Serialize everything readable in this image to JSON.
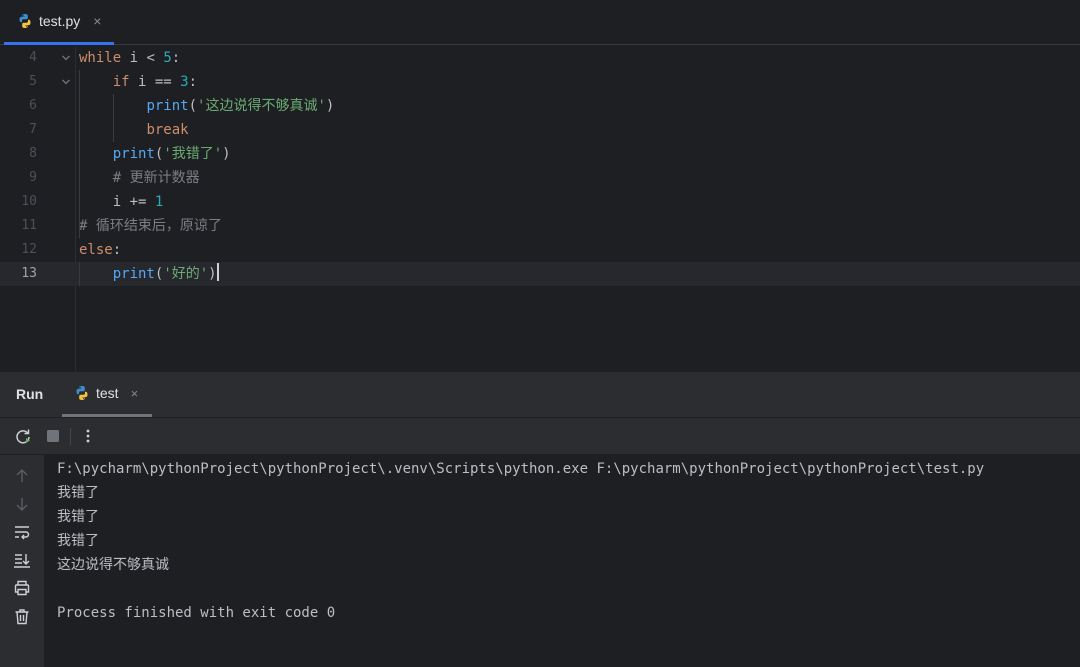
{
  "editor_tab": {
    "label": "test.py",
    "close": "×"
  },
  "editor": {
    "lines": [
      {
        "num": "4",
        "tokens": [
          [
            "kw",
            "while"
          ],
          [
            "p",
            " i < "
          ],
          [
            "num",
            "5"
          ],
          [
            "p",
            ":"
          ]
        ]
      },
      {
        "num": "5",
        "tokens": [
          [
            "p",
            "    "
          ],
          [
            "kw",
            "if"
          ],
          [
            "p",
            " i == "
          ],
          [
            "num",
            "3"
          ],
          [
            "p",
            ":"
          ]
        ]
      },
      {
        "num": "6",
        "tokens": [
          [
            "p",
            "        "
          ],
          [
            "fn",
            "print"
          ],
          [
            "p",
            "("
          ],
          [
            "str",
            "'这边说得不够真诚'"
          ],
          [
            "p",
            ")"
          ]
        ]
      },
      {
        "num": "7",
        "tokens": [
          [
            "p",
            "        "
          ],
          [
            "kw",
            "break"
          ]
        ]
      },
      {
        "num": "8",
        "tokens": [
          [
            "p",
            "    "
          ],
          [
            "fn",
            "print"
          ],
          [
            "p",
            "("
          ],
          [
            "str",
            "'我错了'"
          ],
          [
            "p",
            ")"
          ]
        ]
      },
      {
        "num": "9",
        "tokens": [
          [
            "p",
            "    "
          ],
          [
            "cmt",
            "# 更新计数器"
          ]
        ]
      },
      {
        "num": "10",
        "tokens": [
          [
            "p",
            "    i += "
          ],
          [
            "num",
            "1"
          ]
        ]
      },
      {
        "num": "11",
        "tokens": [
          [
            "cmt",
            "# 循环结束后，原谅了"
          ]
        ]
      },
      {
        "num": "12",
        "tokens": [
          [
            "kw",
            "else"
          ],
          [
            "p",
            ":"
          ]
        ]
      },
      {
        "num": "13",
        "tokens": [
          [
            "p",
            "    "
          ],
          [
            "fn",
            "print"
          ],
          [
            "p",
            "("
          ],
          [
            "str",
            "'好的'"
          ],
          [
            "p",
            ")"
          ]
        ]
      }
    ],
    "current_line": "13"
  },
  "run_panel": {
    "title": "Run",
    "tab_label": "test",
    "tab_close": "×",
    "console_lines": [
      "F:\\pycharm\\pythonProject\\pythonProject\\.venv\\Scripts\\python.exe F:\\pycharm\\pythonProject\\pythonProject\\test.py",
      "我错了",
      "我错了",
      "我错了",
      "这边说得不够真诚",
      "",
      "Process finished with exit code 0"
    ]
  },
  "icons": {
    "file_type": "python-icon",
    "rerun": "rerun-icon",
    "stop": "stop-icon",
    "more": "more-vertical-icon",
    "up": "arrow-up-icon",
    "down": "arrow-down-icon",
    "wrap": "soft-wrap-icon",
    "scroll_end": "scroll-to-end-icon",
    "print": "print-icon",
    "trash": "trash-icon"
  },
  "colors": {
    "keyword": "#cf8e6d",
    "number": "#2aacb8",
    "function": "#56a8f5",
    "string": "#6aab73",
    "comment": "#7a7e85",
    "accent": "#3574f0"
  }
}
